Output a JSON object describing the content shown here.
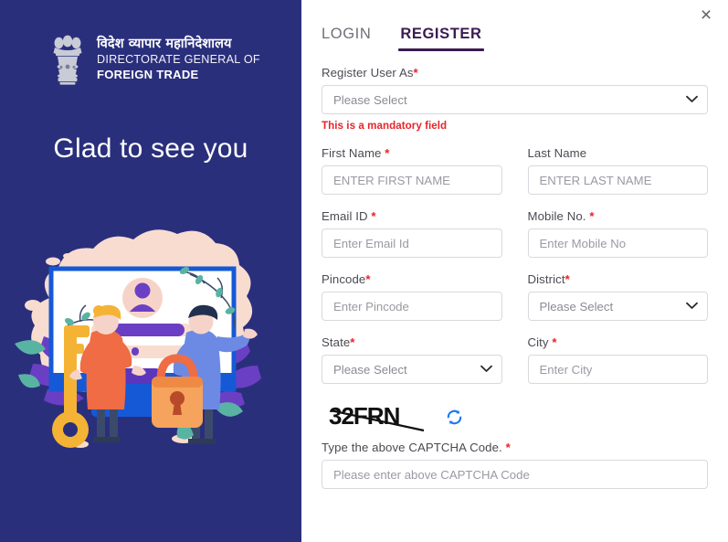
{
  "left": {
    "brand": {
      "hindi": "विदेश व्यापार महानिदेशालय",
      "line1": "DIRECTORATE GENERAL OF",
      "line2": "FOREIGN TRADE",
      "emblem_icon": "ashoka-lion-capital-emblem"
    },
    "headline": "Glad to see you",
    "illustration_icon": "login-security-illustration",
    "bg_color": "#2a2f7c"
  },
  "header": {
    "close_icon": "close-icon",
    "close_label": "×"
  },
  "tabs": [
    {
      "id": "login",
      "label": "LOGIN",
      "active": false
    },
    {
      "id": "register",
      "label": "REGISTER",
      "active": true
    }
  ],
  "accent_color": "#3c1a52",
  "error_color": "#e8242a",
  "form": {
    "register_user_as": {
      "label": "Register User As",
      "required": true,
      "value": "Please Select",
      "options": [
        "Please Select"
      ],
      "error": "This is a mandatory field",
      "chevron_icon": "chevron-down-icon"
    },
    "first_name": {
      "label": "First Name",
      "required": true,
      "placeholder": "ENTER FIRST NAME",
      "value": ""
    },
    "last_name": {
      "label": "Last Name",
      "required": false,
      "placeholder": "ENTER LAST NAME",
      "value": ""
    },
    "email": {
      "label": "Email ID",
      "required": true,
      "placeholder": "Enter Email Id",
      "value": ""
    },
    "mobile": {
      "label": "Mobile No.",
      "required": true,
      "placeholder": "Enter Mobile No",
      "value": ""
    },
    "pincode": {
      "label": "Pincode",
      "required": true,
      "placeholder": "Enter Pincode",
      "value": ""
    },
    "district": {
      "label": "District",
      "required": true,
      "value": "Please Select",
      "options": [
        "Please Select"
      ],
      "chevron_icon": "chevron-down-icon"
    },
    "state": {
      "label": "State",
      "required": true,
      "value": "Please Select",
      "options": [
        "Please Select"
      ],
      "chevron_icon": "chevron-down-icon"
    },
    "city": {
      "label": "City",
      "required": true,
      "placeholder": "Enter City",
      "value": ""
    },
    "captcha": {
      "code": "32FRN",
      "refresh_icon": "refresh-icon",
      "label": "Type the above CAPTCHA Code.",
      "required": true,
      "placeholder": "Please enter above CAPTCHA Code",
      "value": ""
    }
  }
}
